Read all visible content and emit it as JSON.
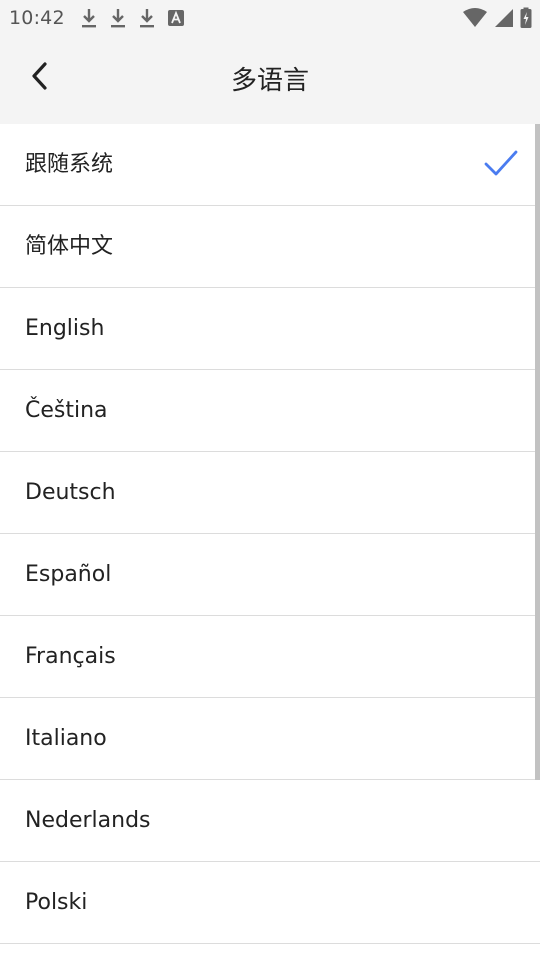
{
  "status_bar": {
    "time": "10:42",
    "left_icons": [
      "download-icon",
      "download-icon",
      "download-icon",
      "keyboard-a-icon"
    ],
    "right_icons": [
      "wifi-icon",
      "cellular-signal-icon",
      "battery-charging-icon"
    ]
  },
  "app_bar": {
    "title": "多语言",
    "back_icon": "chevron-left-icon"
  },
  "languages": [
    {
      "label": "跟随系统",
      "selected": true
    },
    {
      "label": "简体中文",
      "selected": false
    },
    {
      "label": "English",
      "selected": false
    },
    {
      "label": "Čeština",
      "selected": false
    },
    {
      "label": "Deutsch",
      "selected": false
    },
    {
      "label": "Español",
      "selected": false
    },
    {
      "label": "Français",
      "selected": false
    },
    {
      "label": "Italiano",
      "selected": false
    },
    {
      "label": "Nederlands",
      "selected": false
    },
    {
      "label": "Polski",
      "selected": false
    }
  ],
  "colors": {
    "accent": "#4a7cf0",
    "bar_background": "#f4f4f4",
    "divider": "#dcdcdc",
    "text": "#222222"
  }
}
